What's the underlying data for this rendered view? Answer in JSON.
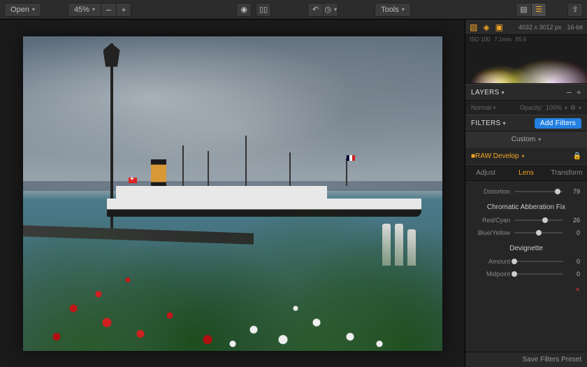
{
  "toolbar": {
    "open_label": "Open",
    "zoom_level": "45%",
    "tools_label": "Tools"
  },
  "meta": {
    "dimensions": "4032 x 3012 px",
    "bit_depth": "16-bit"
  },
  "histogram": {
    "iso": "ISO 100",
    "focal": "7.1mm",
    "aperture": "f/5.6"
  },
  "layers": {
    "title": "LAYERS",
    "blend_mode": "Normal",
    "opacity_label": "Opacity:",
    "opacity_value": "100%"
  },
  "filters": {
    "title": "FILTERS",
    "add_label": "Add Filters",
    "preset_label": "Custom"
  },
  "raw_develop": {
    "title": "RAW Develop",
    "tabs": {
      "adjust": "Adjust",
      "lens": "Lens",
      "transform": "Transform"
    },
    "distortion": {
      "label": "Distortion",
      "value": 79,
      "pos": 89
    },
    "caf_heading": "Chromatic Abberation Fix",
    "red_cyan": {
      "label": "Red/Cyan",
      "value": 26,
      "pos": 63
    },
    "blue_yellow": {
      "label": "Blue/Yellow",
      "value": 0,
      "pos": 50
    },
    "devignette_heading": "Devignette",
    "amount": {
      "label": "Amount",
      "value": 0,
      "pos": 0
    },
    "midpoint": {
      "label": "Midpoint",
      "value": 0,
      "pos": 0
    }
  },
  "footer": {
    "save_preset_label": "Save Filters Preset"
  }
}
